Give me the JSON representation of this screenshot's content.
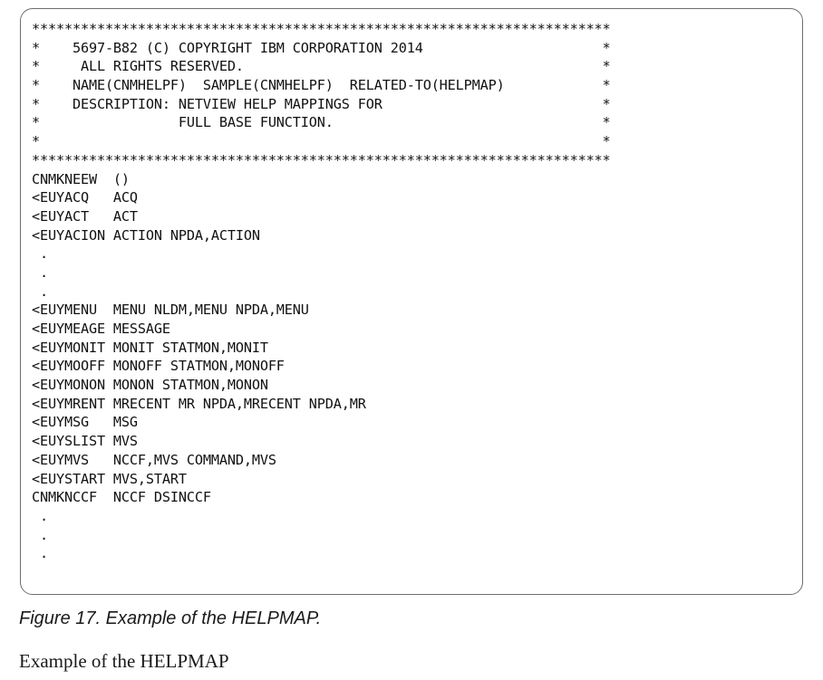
{
  "code_example": {
    "lines": [
      "***********************************************************************",
      "*    5697-B82 (C) COPYRIGHT IBM CORPORATION 2014                      *",
      "*     ALL RIGHTS RESERVED.                                            *",
      "*    NAME(CNMHELPF)  SAMPLE(CNMHELPF)  RELATED-TO(HELPMAP)            *",
      "*    DESCRIPTION: NETVIEW HELP MAPPINGS FOR                           *",
      "*                 FULL BASE FUNCTION.                                 *",
      "*                                                                     *",
      "***********************************************************************",
      "CNMKNEEW  ()",
      "<EUYACQ   ACQ",
      "<EUYACT   ACT",
      "<EUYACION ACTION NPDA,ACTION",
      " .",
      " .",
      " .",
      "<EUYMENU  MENU NLDM,MENU NPDA,MENU",
      "<EUYMEAGE MESSAGE",
      "<EUYMONIT MONIT STATMON,MONIT",
      "<EUYMOOFF MONOFF STATMON,MONOFF",
      "<EUYMONON MONON STATMON,MONON",
      "<EUYMRENT MRECENT MR NPDA,MRECENT NPDA,MR",
      "<EUYMSG   MSG",
      "<EUYSLIST MVS",
      "<EUYMVS   NCCF,MVS COMMAND,MVS",
      "<EUYSTART MVS,START",
      "CNMKNCCF  NCCF DSINCCF",
      " .",
      " .",
      " ."
    ]
  },
  "figure": {
    "caption": "Figure 17. Example of the HELPMAP."
  },
  "body": {
    "text": "Example of the HELPMAP"
  }
}
